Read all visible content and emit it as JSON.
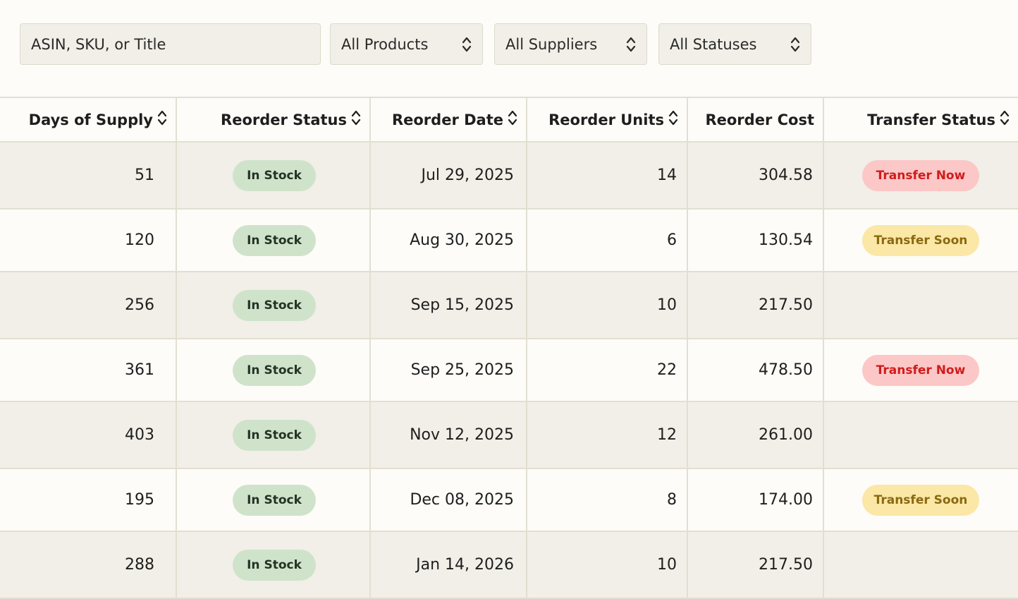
{
  "filters": {
    "search_placeholder": "ASIN, SKU, or Title",
    "products_label": "All Products",
    "suppliers_label": "All Suppliers",
    "statuses_label": "All Statuses"
  },
  "table": {
    "columns": [
      {
        "label": "Days of Supply",
        "sortable": true
      },
      {
        "label": "Reorder Status",
        "sortable": true
      },
      {
        "label": "Reorder Date",
        "sortable": true
      },
      {
        "label": "Reorder Units",
        "sortable": true
      },
      {
        "label": "Reorder Cost",
        "sortable": false
      },
      {
        "label": "Transfer Status",
        "sortable": true
      }
    ],
    "rows": [
      {
        "days": "51",
        "status": "In Stock",
        "date": "Jul 29, 2025",
        "units": "14",
        "cost": "304.58",
        "transfer": "Transfer Now",
        "transfer_type": "now"
      },
      {
        "days": "120",
        "status": "In Stock",
        "date": "Aug 30, 2025",
        "units": "6",
        "cost": "130.54",
        "transfer": "Transfer Soon",
        "transfer_type": "soon"
      },
      {
        "days": "256",
        "status": "In Stock",
        "date": "Sep 15, 2025",
        "units": "10",
        "cost": "217.50",
        "transfer": "",
        "transfer_type": "none"
      },
      {
        "days": "361",
        "status": "In Stock",
        "date": "Sep 25, 2025",
        "units": "22",
        "cost": "478.50",
        "transfer": "Transfer Now",
        "transfer_type": "now"
      },
      {
        "days": "403",
        "status": "In Stock",
        "date": "Nov 12, 2025",
        "units": "12",
        "cost": "261.00",
        "transfer": "",
        "transfer_type": "none"
      },
      {
        "days": "195",
        "status": "In Stock",
        "date": "Dec 08, 2025",
        "units": "8",
        "cost": "174.00",
        "transfer": "Transfer Soon",
        "transfer_type": "soon"
      },
      {
        "days": "288",
        "status": "In Stock",
        "date": "Jan 14, 2026",
        "units": "10",
        "cost": "217.50",
        "transfer": "",
        "transfer_type": "none"
      }
    ]
  },
  "colors": {
    "page_bg": "#fdfcf8",
    "alt_row_bg": "#f1efe7",
    "in_stock_bg": "#cfe3cb",
    "transfer_now_bg": "#fcc7c7",
    "transfer_now_text": "#d01c1c",
    "transfer_soon_bg": "#fbe7a6",
    "transfer_soon_text": "#8a6a10"
  },
  "icons": {
    "sort": "sort-chevrons-icon",
    "select": "select-chevrons-icon"
  }
}
